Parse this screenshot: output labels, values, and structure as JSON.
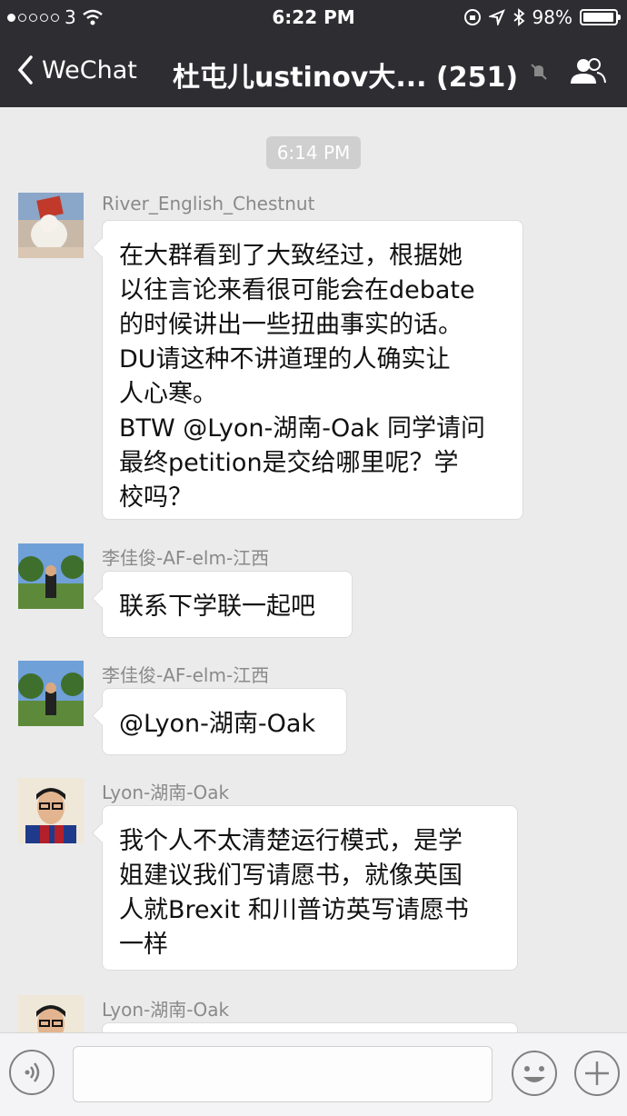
{
  "status_bar": {
    "carrier": "3",
    "time": "6:22 PM",
    "battery": "98%",
    "battery_level": 0.98
  },
  "nav": {
    "back_label": "WeChat",
    "title": "杜屯儿ustinov大... (251)"
  },
  "chat": {
    "timestamp": "6:14 PM",
    "messages": [
      {
        "sender": "River_English_Chestnut",
        "lines": [
          "在大群看到了大致经过，根据她",
          "以往言论来看很可能会在debate",
          "的时候讲出一些扭曲事实的话。",
          "DU请这种不讲道理的人确实让",
          "人心寒。",
          "BTW @Lyon-湖南-Oak 同学请问",
          "最终petition是交给哪里呢？学",
          "校吗？"
        ]
      },
      {
        "sender": "李佳俊-AF-elm-江西",
        "lines": [
          "联系下学联一起吧"
        ]
      },
      {
        "sender": "李佳俊-AF-elm-江西",
        "lines": [
          "@Lyon-湖南-Oak"
        ]
      },
      {
        "sender": "Lyon-湖南-Oak",
        "lines": [
          "我个人不太清楚运行模式，是学",
          "姐建议我们写请愿书，就像英国",
          "人就Brexit 和川普访英写请愿书",
          "一样"
        ]
      },
      {
        "sender": "Lyon-湖南-Oak",
        "lines": [
          ""
        ]
      }
    ]
  },
  "input_bar": {
    "voice_icon": "voice-icon",
    "emoji_icon": "emoji-icon",
    "add_icon": "plus-icon"
  },
  "colors": {
    "header_bg": "#2e2e32",
    "chat_bg": "#ebebeb",
    "bubble_bg": "#ffffff"
  }
}
